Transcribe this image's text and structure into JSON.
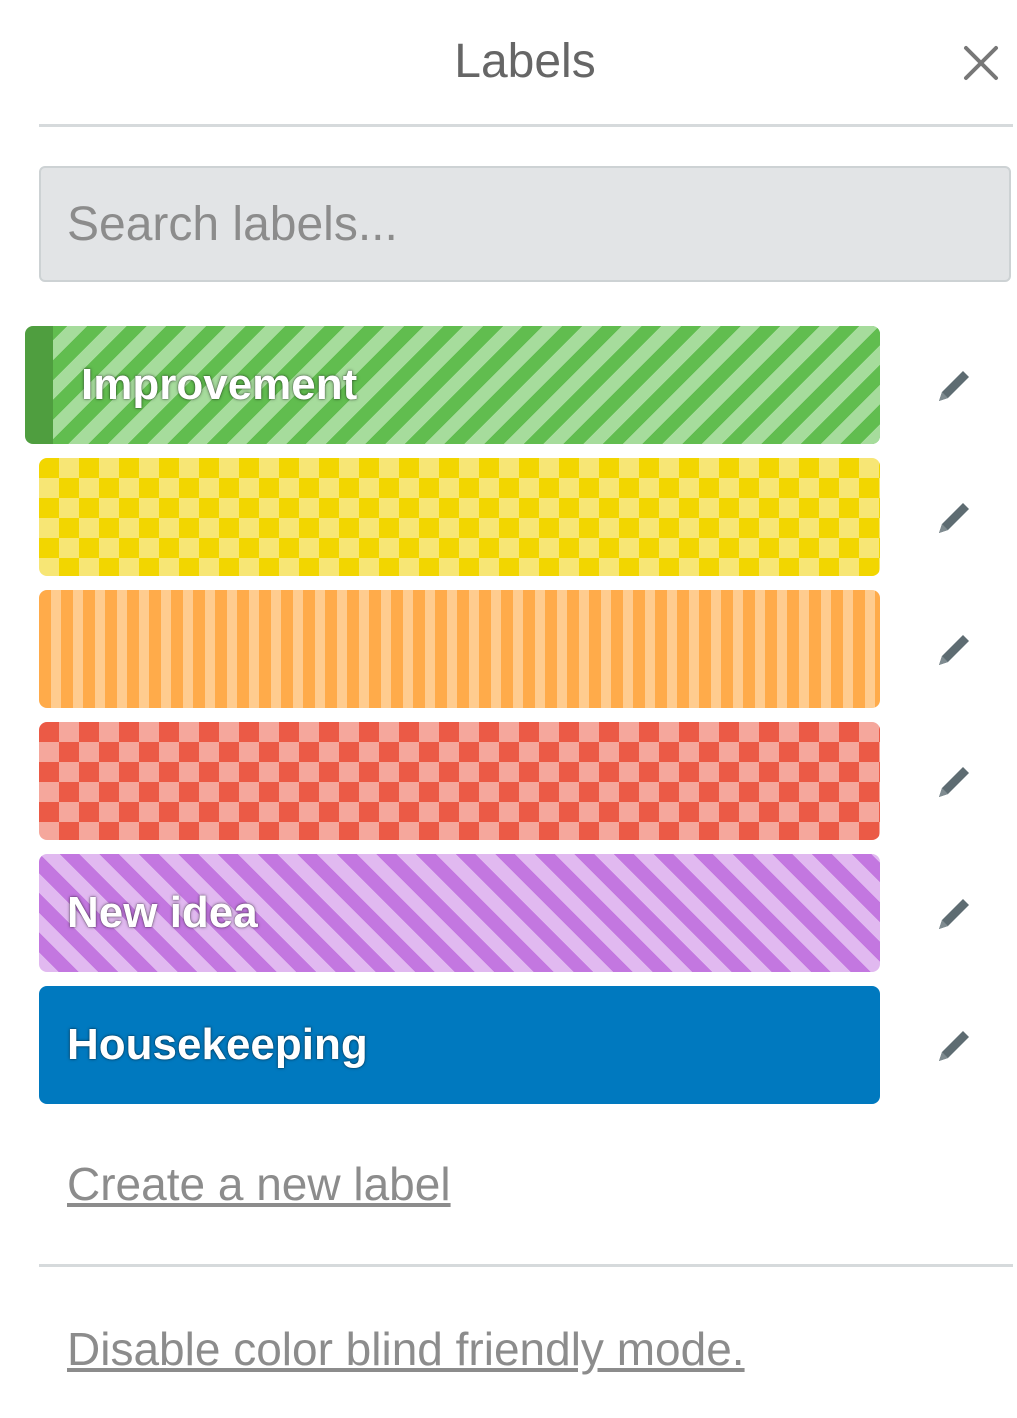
{
  "header": {
    "title": "Labels",
    "close_icon": "close-icon"
  },
  "search": {
    "placeholder": "Search labels...",
    "value": ""
  },
  "labels": [
    {
      "text": "Improvement",
      "color": "#61bd4f",
      "pattern": "diagonal-stripes",
      "selected": true
    },
    {
      "text": "",
      "color": "#f2d600",
      "pattern": "diamonds",
      "selected": false
    },
    {
      "text": "",
      "color": "#ffab4a",
      "pattern": "vertical-stripes",
      "selected": false
    },
    {
      "text": "",
      "color": "#eb5a46",
      "pattern": "diamonds",
      "selected": false
    },
    {
      "text": "New idea",
      "color": "#c377e0",
      "pattern": "diagonal-stripes",
      "selected": false
    },
    {
      "text": "Housekeeping",
      "color": "#0079bf",
      "pattern": "solid",
      "selected": false
    }
  ],
  "edit_icon": "pencil-icon",
  "footer": {
    "create_label": "Create a new label",
    "colorblind_toggle": "Disable color blind friendly mode."
  }
}
